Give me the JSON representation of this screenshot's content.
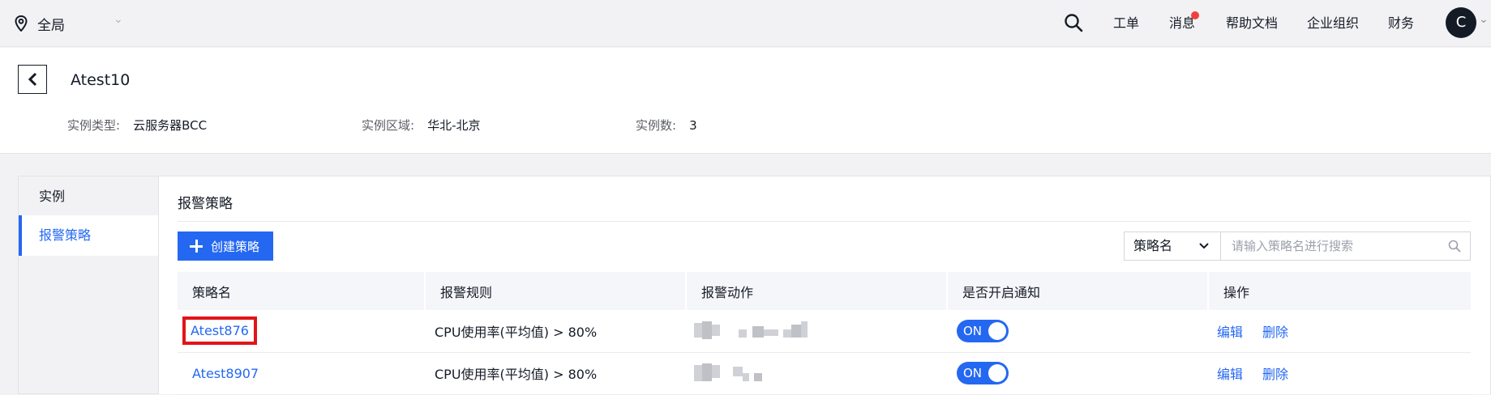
{
  "topbar": {
    "region_label": "全局",
    "nav": [
      "工单",
      "消息",
      "帮助文档",
      "企业组织",
      "财务"
    ],
    "avatar_letter": "C"
  },
  "header": {
    "title": "Atest10",
    "meta": [
      {
        "key": "实例类型:",
        "value": "云服务器BCC"
      },
      {
        "key": "实例区域:",
        "value": "华北-北京"
      },
      {
        "key": "实例数:",
        "value": "3"
      }
    ]
  },
  "sidebar": {
    "items": [
      {
        "label": "实例"
      },
      {
        "label": "报警策略"
      }
    ]
  },
  "main": {
    "section_title": "报警策略",
    "create_button_label": "创建策略",
    "search_select_value": "策略名",
    "search_placeholder": "请输入策略名进行搜索",
    "table": {
      "headers": [
        "策略名",
        "报警规则",
        "报警动作",
        "是否开启通知",
        "操作"
      ],
      "rows": [
        {
          "name": "Atest876",
          "rule": "CPU使用率(平均值) > 80%",
          "notify": "ON",
          "edit": "编辑",
          "delete": "删除"
        },
        {
          "name": "Atest8907",
          "rule": "CPU使用率(平均值) > 80%",
          "notify": "ON",
          "edit": "编辑",
          "delete": "删除"
        }
      ]
    }
  }
}
